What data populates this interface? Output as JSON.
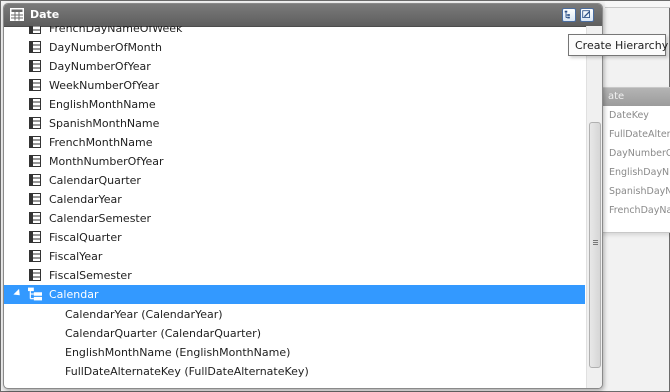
{
  "window": {
    "title": "Date"
  },
  "tooltip": {
    "text": "Create Hierarchy"
  },
  "background_table": {
    "header": "ate",
    "rows": [
      "DateKey",
      "FullDateAlter",
      "DayNumberO",
      "EnglishDayN",
      "SpanishDayN",
      "FrenchDayNa"
    ]
  },
  "columns": [
    "FrenchDayNameOfWeek",
    "DayNumberOfMonth",
    "DayNumberOfYear",
    "WeekNumberOfYear",
    "EnglishMonthName",
    "SpanishMonthName",
    "FrenchMonthName",
    "MonthNumberOfYear",
    "CalendarQuarter",
    "CalendarYear",
    "CalendarSemester",
    "FiscalQuarter",
    "FiscalYear",
    "FiscalSemester"
  ],
  "hierarchy": {
    "name": "Calendar",
    "levels": [
      "CalendarYear  (CalendarYear)",
      "CalendarQuarter  (CalendarQuarter)",
      "EnglishMonthName  (EnglishMonthName)",
      "FullDateAlternateKey  (FullDateAlternateKey)"
    ]
  },
  "icons": {
    "table": "table-icon",
    "column": "column-icon",
    "hierarchy": "hierarchy-icon",
    "create_hierarchy": "create-hierarchy-icon",
    "edit": "edit-icon"
  },
  "colors": {
    "header": "#6b6b6b",
    "selection": "#3399ff"
  }
}
